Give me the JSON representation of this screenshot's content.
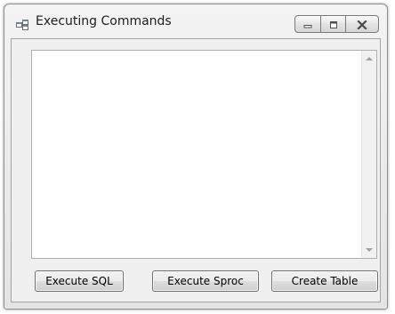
{
  "window": {
    "title": "Executing Commands",
    "icons": {
      "app": "application-window-icon",
      "minimize": "minimize-icon",
      "maximize": "maximize-icon",
      "close": "close-icon"
    }
  },
  "output": {
    "value": "",
    "scroll_up_icon": "scroll-up-arrow-icon",
    "scroll_down_icon": "scroll-down-arrow-icon"
  },
  "buttons": {
    "execute_sql": "Execute SQL",
    "execute_sproc": "Execute Sproc",
    "create_table": "Create Table"
  }
}
